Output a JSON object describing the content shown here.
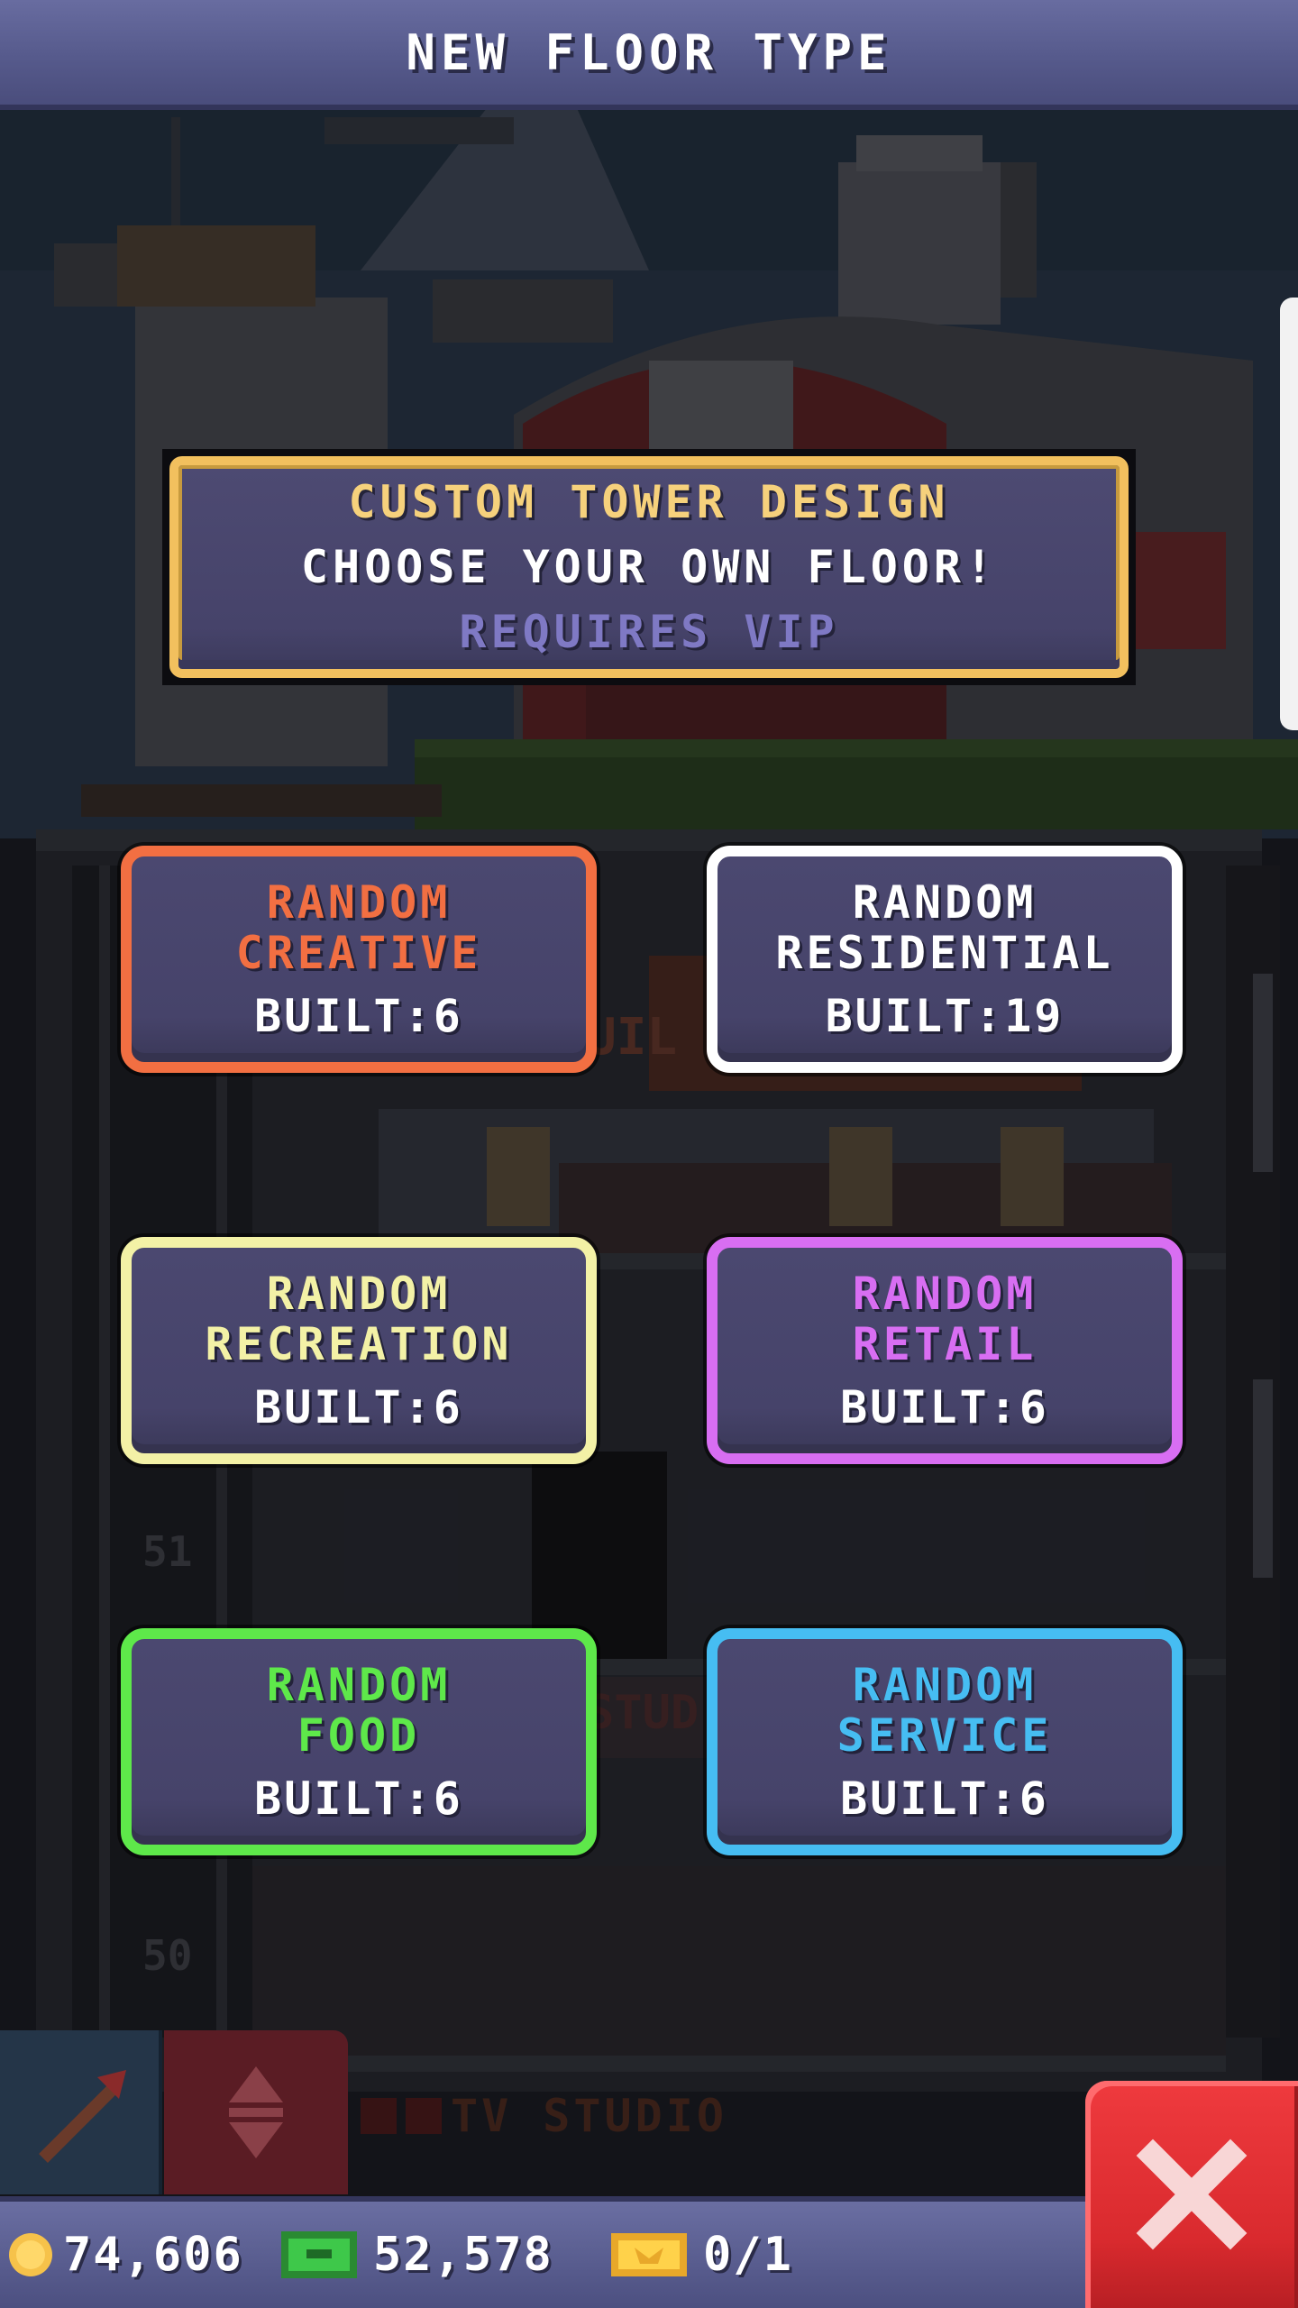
{
  "header": {
    "title": "NEW FLOOR TYPE"
  },
  "vip_panel": {
    "title": "CUSTOM TOWER DESIGN",
    "subtitle": "CHOOSE YOUR OWN FLOOR!",
    "requirement": "REQUIRES VIP",
    "colors": {
      "border": "#f2c05e",
      "title": "#f6d17c",
      "requirement": "#7f79c4"
    }
  },
  "categories": [
    {
      "line1": "RANDOM",
      "line2": "CREATIVE",
      "built_label": "BUILT:",
      "built_count": "6",
      "color": "#f26f42"
    },
    {
      "line1": "RANDOM",
      "line2": "RESIDENTIAL",
      "built_label": "BUILT:",
      "built_count": "19",
      "color": "#ffffff"
    },
    {
      "line1": "RANDOM",
      "line2": "RECREATION",
      "built_label": "BUILT:",
      "built_count": "6",
      "color": "#f3f1a6"
    },
    {
      "line1": "RANDOM",
      "line2": "RETAIL",
      "built_label": "BUILT:",
      "built_count": "6",
      "color": "#d86ef2"
    },
    {
      "line1": "RANDOM",
      "line2": "FOOD",
      "built_label": "BUILT:",
      "built_count": "6",
      "color": "#5ee84a"
    },
    {
      "line1": "RANDOM",
      "line2": "SERVICE",
      "built_label": "BUILT:",
      "built_count": "6",
      "color": "#46bdf2"
    }
  ],
  "background": {
    "floor_numbers": [
      "51",
      "50"
    ],
    "floor_sign": "TV STUDIO",
    "sign_partial": "UIL",
    "sign_partial_2": "STUD"
  },
  "resources": {
    "coins": "74,606",
    "bux": "52,578",
    "vip_tickets": "0/1"
  },
  "icons": {
    "coin": "coin-icon",
    "bux": "bux-icon",
    "ticket": "golden-ticket-icon",
    "close": "close-icon",
    "pickaxe": "pickaxe-icon",
    "elevator": "elevator-arrows-icon"
  }
}
